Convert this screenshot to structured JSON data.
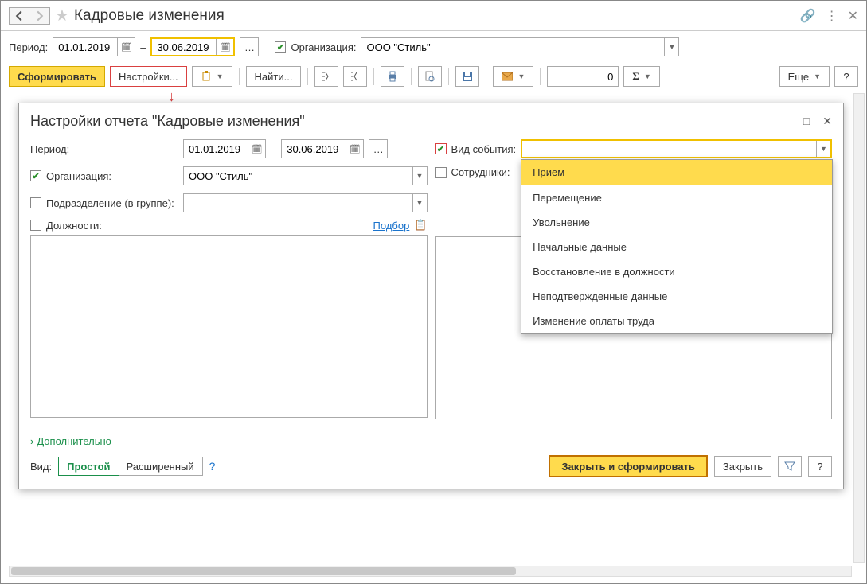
{
  "window": {
    "title": "Кадровые изменения"
  },
  "filter": {
    "period_label": "Период:",
    "date_from": "01.01.2019",
    "dash": "–",
    "date_to": "30.06.2019",
    "org_label": "Организация:",
    "org_value": "ООО \"Стиль\""
  },
  "toolbar": {
    "form_btn": "Сформировать",
    "settings_btn": "Настройки...",
    "find_btn": "Найти...",
    "num_value": "0",
    "more_btn": "Еще",
    "help_btn": "?"
  },
  "dialog": {
    "title": "Настройки отчета \"Кадровые изменения\"",
    "period_label": "Период:",
    "date_from": "01.01.2019",
    "dash": "–",
    "date_to": "30.06.2019",
    "event_label": "Вид события:",
    "org_label": "Организация:",
    "org_value": "ООО \"Стиль\"",
    "employees_label": "Сотрудники:",
    "dept_label": "Подразделение (в группе):",
    "positions_label": "Должности:",
    "select_link": "Подбор",
    "expand_label": "Дополнительно",
    "view_label": "Вид:",
    "view_simple": "Простой",
    "view_extended": "Расширенный",
    "help_q": "?",
    "close_form_btn": "Закрыть и сформировать",
    "close_btn": "Закрыть",
    "filter_help_btn": "?",
    "event_options": {
      "o0": "Прием",
      "o1": "Перемещение",
      "o2": "Увольнение",
      "o3": "Начальные данные",
      "o4": "Восстановление в должности",
      "o5": "Неподтвержденные данные",
      "o6": "Изменение оплаты труда"
    }
  }
}
